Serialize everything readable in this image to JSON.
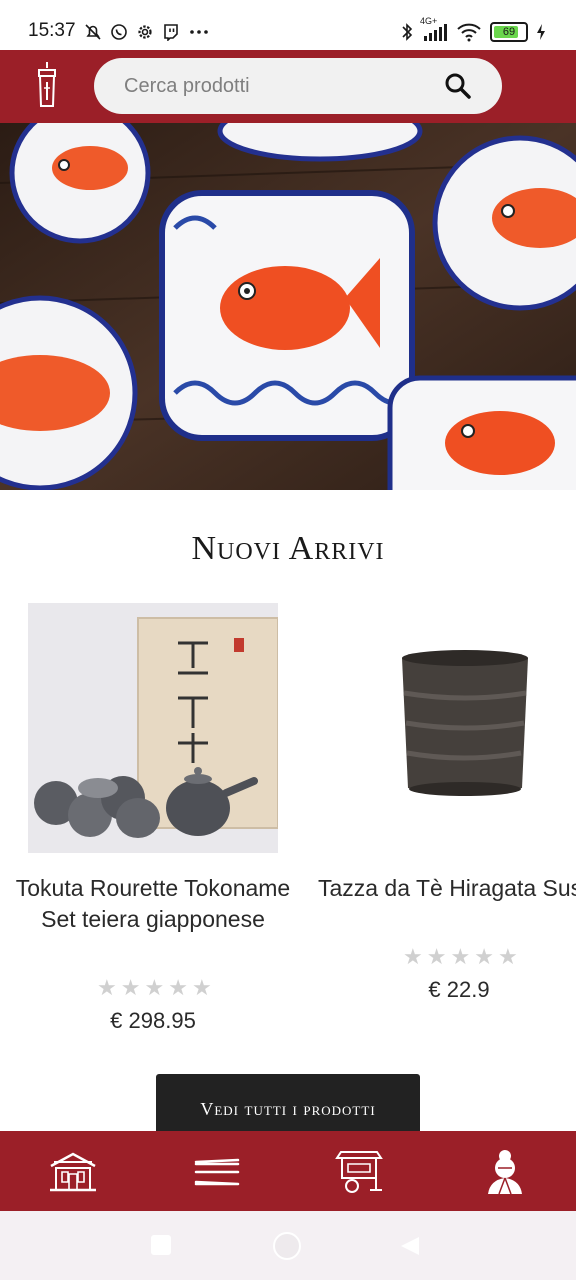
{
  "status_bar": {
    "time": "15:37",
    "network": "4G+",
    "battery": "69",
    "left_icons": [
      "mute-bell-icon",
      "whatsapp-icon",
      "settings-gear-icon",
      "twitch-icon",
      "more-dots-icon"
    ],
    "right_icons": [
      "bluetooth-icon",
      "signal-icon",
      "wifi-icon",
      "battery-icon",
      "charging-icon"
    ]
  },
  "header": {
    "logo": "lantern-logo-icon",
    "search_placeholder": "Cerca prodotti",
    "search_icon": "search-icon"
  },
  "hero": {
    "image": "hero-banner-fish-plates"
  },
  "section": {
    "title": "Nuovi Arrivi"
  },
  "products": [
    {
      "name": "Tokuta Rourette Tokoname Set teiera giapponese",
      "rating": 0,
      "max_rating": 5,
      "price": "€ 298.95"
    },
    {
      "name": "Tazza da Tè Hiragata Sushi",
      "rating": 0,
      "max_rating": 5,
      "price": "€ 22.9"
    }
  ],
  "cta": {
    "label": "Vedi tutti i prodotti"
  },
  "bottom_nav": {
    "items": [
      "home-house-icon",
      "menu-chopsticks-icon",
      "shop-cart-icon",
      "profile-geisha-icon"
    ]
  },
  "colors": {
    "brand": "#9b1f28",
    "cta_bg": "#222222",
    "star": "#d0d0d0"
  }
}
